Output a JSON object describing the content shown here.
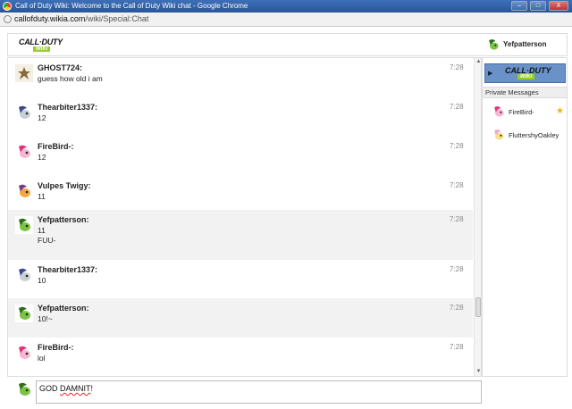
{
  "window": {
    "title": "Call of Duty Wiki: Welcome to the Call of Duty Wiki chat - Google Chrome",
    "url_domain": "callofduty.wikia.com",
    "url_path": "/wiki/Special:Chat",
    "min_label": "–",
    "max_label": "□",
    "close_label": "X"
  },
  "header": {
    "logo_line1": "CALL·DUTY",
    "logo_line2": "WIKI",
    "current_user": "Yefpatterson"
  },
  "messages": [
    {
      "user": "GHOST724:",
      "lines": [
        "guess how old i am"
      ],
      "time": "7:28",
      "alt": false,
      "avatar": "soldier"
    },
    {
      "user": "Thearbiter1337:",
      "lines": [
        "12"
      ],
      "time": "7:28",
      "alt": false,
      "avatar": "grey-pony"
    },
    {
      "user": "FireBird-:",
      "lines": [
        "12"
      ],
      "time": "7:28",
      "alt": false,
      "avatar": "pink-pony"
    },
    {
      "user": "Vulpes Twigy:",
      "lines": [
        "11"
      ],
      "time": "7:28",
      "alt": false,
      "avatar": "orange-pony"
    },
    {
      "user": "Yefpatterson:",
      "lines": [
        "11",
        "FUU-"
      ],
      "time": "7:28",
      "alt": true,
      "avatar": "green-pony"
    },
    {
      "user": "Thearbiter1337:",
      "lines": [
        "10"
      ],
      "time": "7:28",
      "alt": false,
      "avatar": "grey-pony"
    },
    {
      "user": "Yefpatterson:",
      "lines": [
        "10!~"
      ],
      "time": "7:28",
      "alt": true,
      "avatar": "green-pony"
    },
    {
      "user": "FireBird-:",
      "lines": [
        "lol"
      ],
      "time": "7:28",
      "alt": false,
      "avatar": "pink-pony"
    }
  ],
  "rail": {
    "room_logo_line1": "CALL·DUTY",
    "room_logo_line2": "WIKI",
    "pm_header": "Private Messages",
    "pm_users": [
      {
        "name": "FireBird-",
        "starred": true,
        "avatar": "pink-pony"
      },
      {
        "name": "FluttershyOakley",
        "starred": false,
        "avatar": "yellow-pony"
      }
    ]
  },
  "input": {
    "prefix": "GOD ",
    "misspelled": "DAMNIT",
    "suffix": "!"
  },
  "colors": {
    "title_bar": "#2a5699",
    "room_bg": "#6a92c8",
    "alt_row": "#f2f2f2",
    "star": "#f5b400"
  }
}
